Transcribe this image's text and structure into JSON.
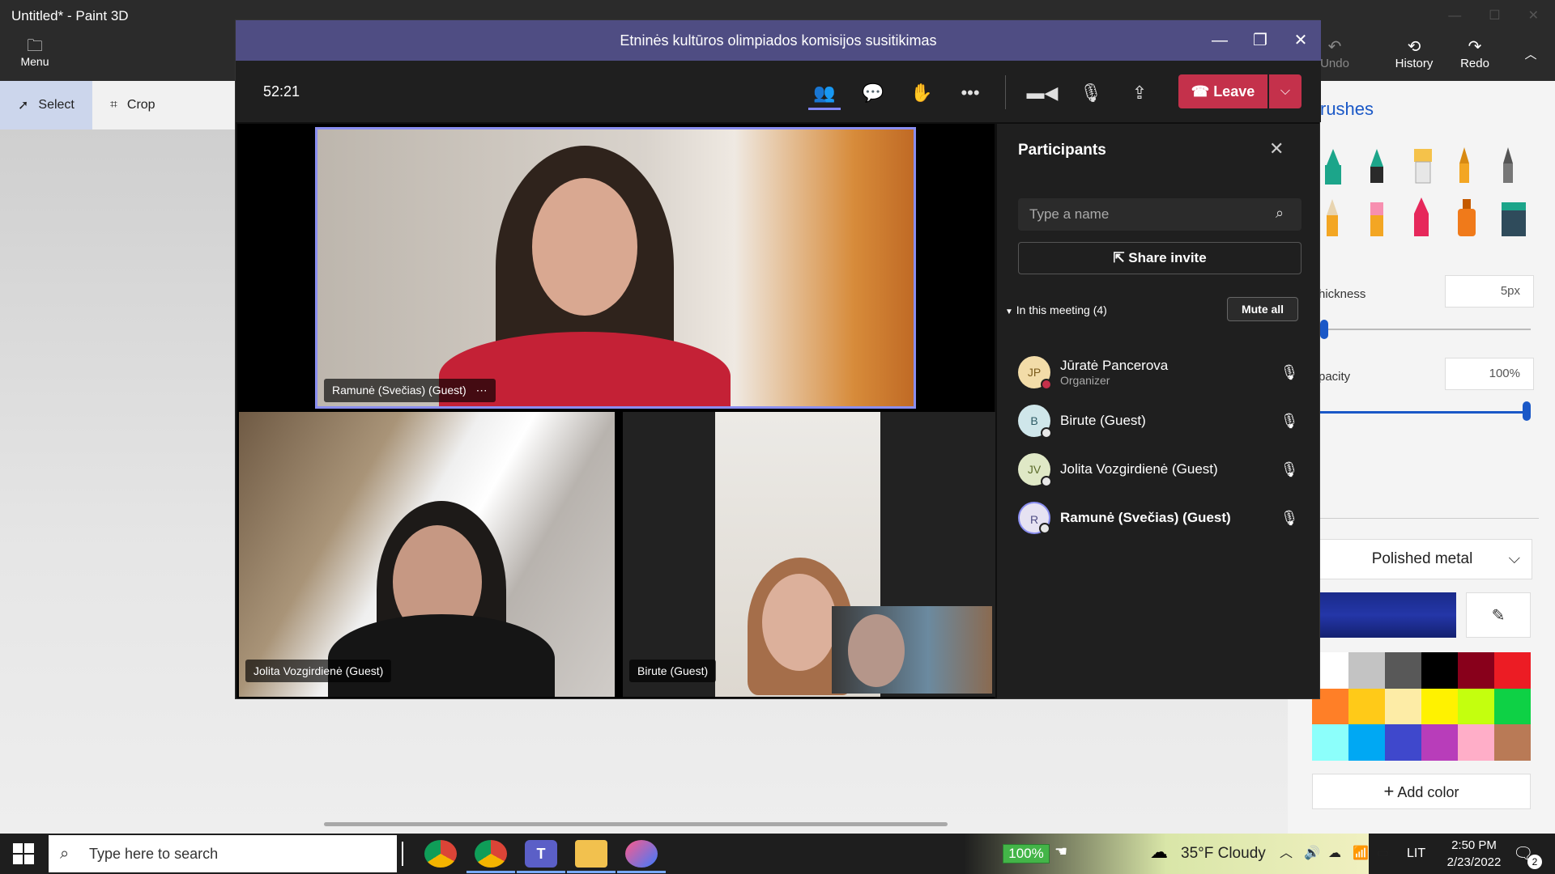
{
  "paint3d": {
    "title": "Untitled* - Paint 3D",
    "menu_label": "Menu",
    "tools": [
      {
        "label": "Select"
      },
      {
        "label": "Crop"
      }
    ],
    "undo_label": "Undo",
    "history_label": "History",
    "redo_label": "Redo",
    "brushes_heading": "rushes",
    "thickness_label": "hickness",
    "thickness_value": "5px",
    "opacity_label": "pacity",
    "opacity_value": "100%",
    "texture_select": "Polished metal",
    "add_color_label": "Add color",
    "palette": [
      "#ffffff",
      "#c3c3c3",
      "#585858",
      "#000000",
      "#88001b",
      "#ec1c24",
      "#ff7f27",
      "#ffca18",
      "#fdeca6",
      "#fff200",
      "#c4ff0e",
      "#0ed145",
      "#8cfffb",
      "#00a8f3",
      "#3f48cc",
      "#b83dba",
      "#ffaec8",
      "#b97a56"
    ],
    "main_color": "#2436a8"
  },
  "teams": {
    "title": "Etninės kultūros olimpiados komisijos susitikimas",
    "timer": "52:21",
    "leave_label": "Leave",
    "videos": {
      "main_label": "Ramunė (Svečias) (Guest)",
      "bottom_left_label": "Jolita Vozgirdienė (Guest)",
      "bottom_right_label": "Birute (Guest)"
    },
    "participants": {
      "title": "Participants",
      "search_placeholder": "Type a name",
      "share_invite": "Share invite",
      "section_label": "In this meeting (4)",
      "mute_all": "Mute all",
      "list": [
        {
          "initials": "JP",
          "name": "Jūratė Pancerova",
          "role": "Organizer"
        },
        {
          "initials": "B",
          "name": "Birute (Guest)",
          "role": ""
        },
        {
          "initials": "JV",
          "name": "Jolita Vozgirdienė (Guest)",
          "role": ""
        },
        {
          "initials": "R",
          "name": "Ramunė (Svečias) (Guest)",
          "role": ""
        }
      ]
    }
  },
  "taskbar": {
    "search_placeholder": "Type here to search",
    "zoom_badge": "100%",
    "weather": "35°F  Cloudy",
    "language": "LIT",
    "time": "2:50 PM",
    "date": "2/23/2022",
    "notification_count": "2"
  }
}
